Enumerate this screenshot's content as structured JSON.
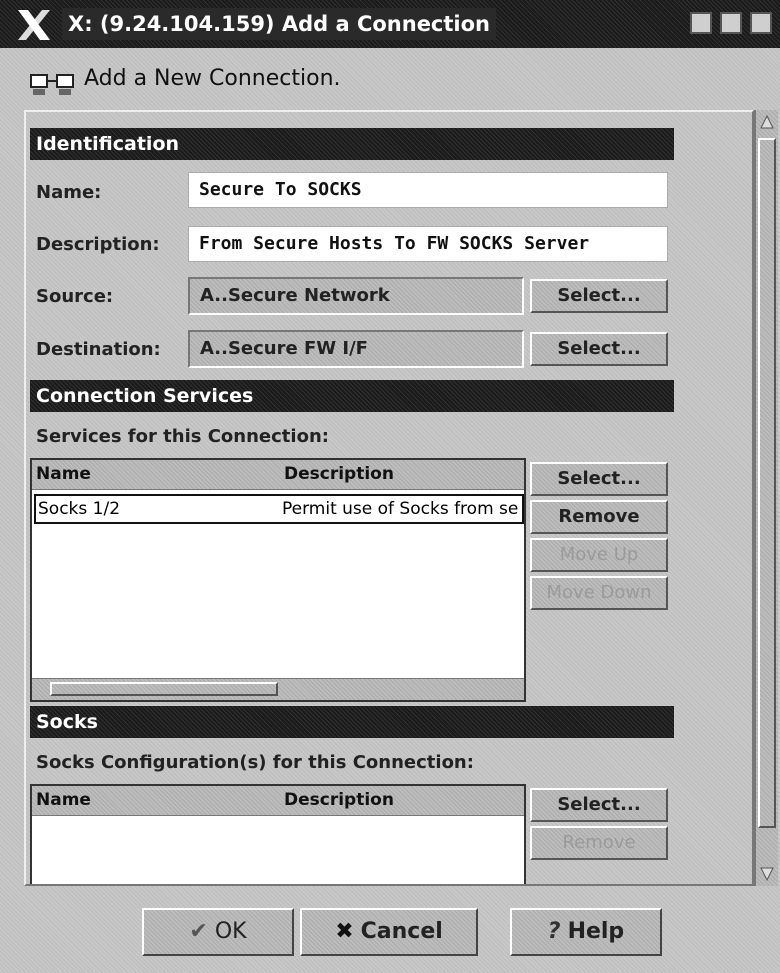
{
  "window": {
    "title": "X: (9.24.104.159) Add a Connection"
  },
  "header": {
    "text": "Add a New Connection."
  },
  "identification": {
    "section_title": "Identification",
    "name_label": "Name:",
    "name_value": "Secure To SOCKS",
    "description_label": "Description:",
    "description_value": "From Secure Hosts To FW SOCKS Server",
    "source_label": "Source:",
    "source_value": "A..Secure Network",
    "source_select": "Select...",
    "destination_label": "Destination:",
    "destination_value": "A..Secure FW I/F",
    "destination_select": "Select..."
  },
  "services": {
    "section_title": "Connection Services",
    "list_label": "Services for this Connection:",
    "columns": [
      "Name",
      "Description"
    ],
    "rows": [
      {
        "name": "Socks 1/2",
        "description": "Permit use of Socks from se"
      }
    ],
    "buttons": {
      "select": "Select...",
      "remove": "Remove",
      "move_up": "Move Up",
      "move_down": "Move Down"
    }
  },
  "socks": {
    "section_title": "Socks",
    "list_label": "Socks Configuration(s) for this Connection:",
    "columns": [
      "Name",
      "Description"
    ],
    "buttons": {
      "select": "Select...",
      "remove": "Remove"
    }
  },
  "footer": {
    "ok": "OK",
    "cancel": "Cancel",
    "help": "Help"
  }
}
